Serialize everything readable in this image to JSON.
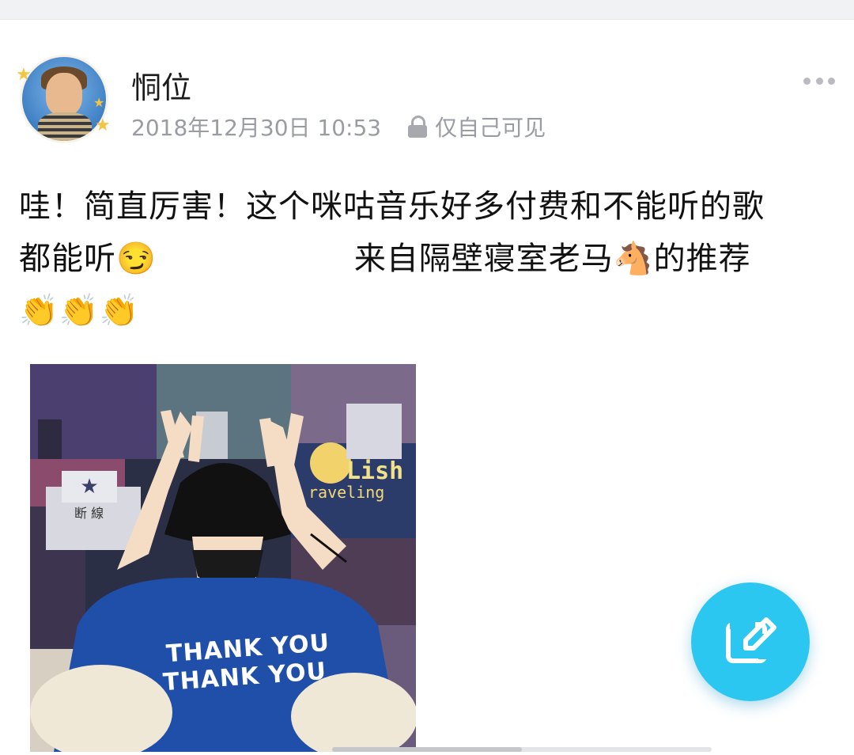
{
  "post": {
    "username": "恫位",
    "timestamp": "2018年12月30日  10:53",
    "visibility": "仅自己可见",
    "text_line1": "哇！简直厉害！这个咪咕音乐好多付费和不能听的歌",
    "text_line2_a": "都能听😏",
    "text_line2_b": "来自隔壁寝室老马🐴的推荐",
    "text_line3": "👏👏👏"
  },
  "image": {
    "shirt_line1": "THANK YOU",
    "shirt_line2": "THANK YOU",
    "poster_title": "Lish",
    "poster_subtitle": "raveling",
    "poster_cn": "断 線"
  },
  "icons": {
    "more": "more-horizontal-icon",
    "lock": "lock-icon",
    "compose": "edit-icon"
  },
  "colors": {
    "fab": "#2cc7f0",
    "meta_text": "#9a9ca3"
  }
}
